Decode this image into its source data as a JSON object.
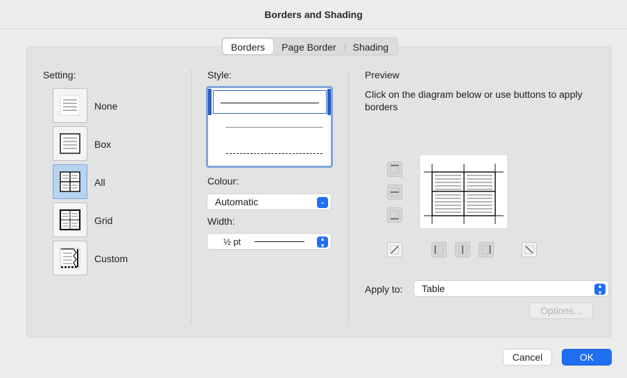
{
  "window": {
    "title": "Borders and Shading"
  },
  "tabs": [
    {
      "label": "Borders",
      "active": true
    },
    {
      "label": "Page Border",
      "active": false
    },
    {
      "label": "Shading",
      "active": false
    }
  ],
  "setting": {
    "label": "Setting:",
    "options": [
      {
        "label": "None",
        "icon": "border-none-icon"
      },
      {
        "label": "Box",
        "icon": "border-box-icon"
      },
      {
        "label": "All",
        "icon": "border-all-icon",
        "selected": true
      },
      {
        "label": "Grid",
        "icon": "border-grid-icon"
      },
      {
        "label": "Custom",
        "icon": "border-custom-icon"
      }
    ]
  },
  "style": {
    "label": "Style:",
    "options": [
      "solid",
      "dotted",
      "dashed"
    ],
    "selected": "solid"
  },
  "colour": {
    "label": "Colour:",
    "value": "Automatic"
  },
  "width": {
    "label": "Width:",
    "value": "½ pt"
  },
  "preview": {
    "label": "Preview",
    "instructions": "Click on the diagram below or use buttons to apply borders"
  },
  "apply_to": {
    "label": "Apply to:",
    "value": "Table"
  },
  "buttons": {
    "options": "Options...",
    "cancel": "Cancel",
    "ok": "OK"
  },
  "colors": {
    "accent": "#1e6ff2",
    "selected_setting": "#b7d3f2"
  }
}
